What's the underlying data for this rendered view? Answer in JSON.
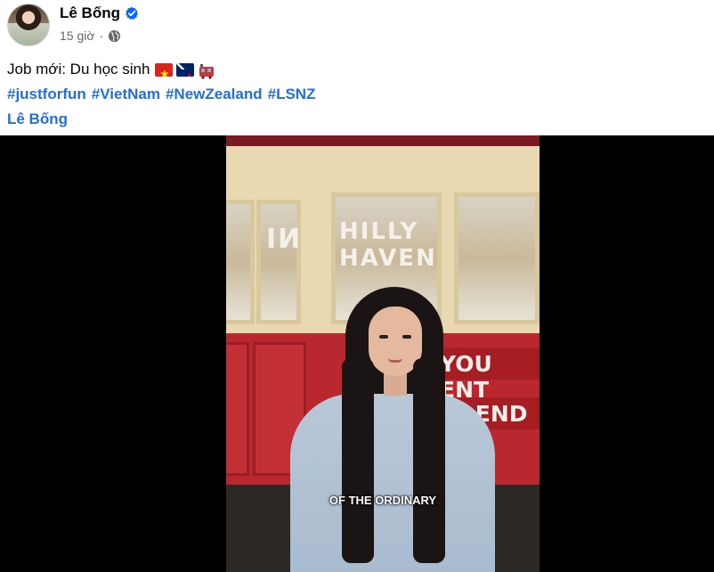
{
  "post": {
    "author": "Lê Bống",
    "time": "15 giờ",
    "separator": "·",
    "text": "Job mới: Du học sinh",
    "hashtags": [
      "#justforfun",
      "#VietNam",
      "#NewZealand",
      "#LSNZ"
    ],
    "mention": "Lê Bống"
  },
  "video": {
    "window_sign_text": "HILLY HAVEN",
    "reflection_text": "NI",
    "side_sign_1": "YOU ENT",
    "side_sign_2": "T END",
    "caption": "OF THE ORDINARY"
  },
  "icons": {
    "verified": "verified-badge-icon",
    "audience": "globe-icon",
    "emojis": [
      "flag-vietnam-icon",
      "flag-new-zealand-icon",
      "tram-icon"
    ]
  },
  "colors": {
    "link_blue": "#216fdb",
    "verified_blue": "#0866ff",
    "meta_gray": "#65676b"
  }
}
